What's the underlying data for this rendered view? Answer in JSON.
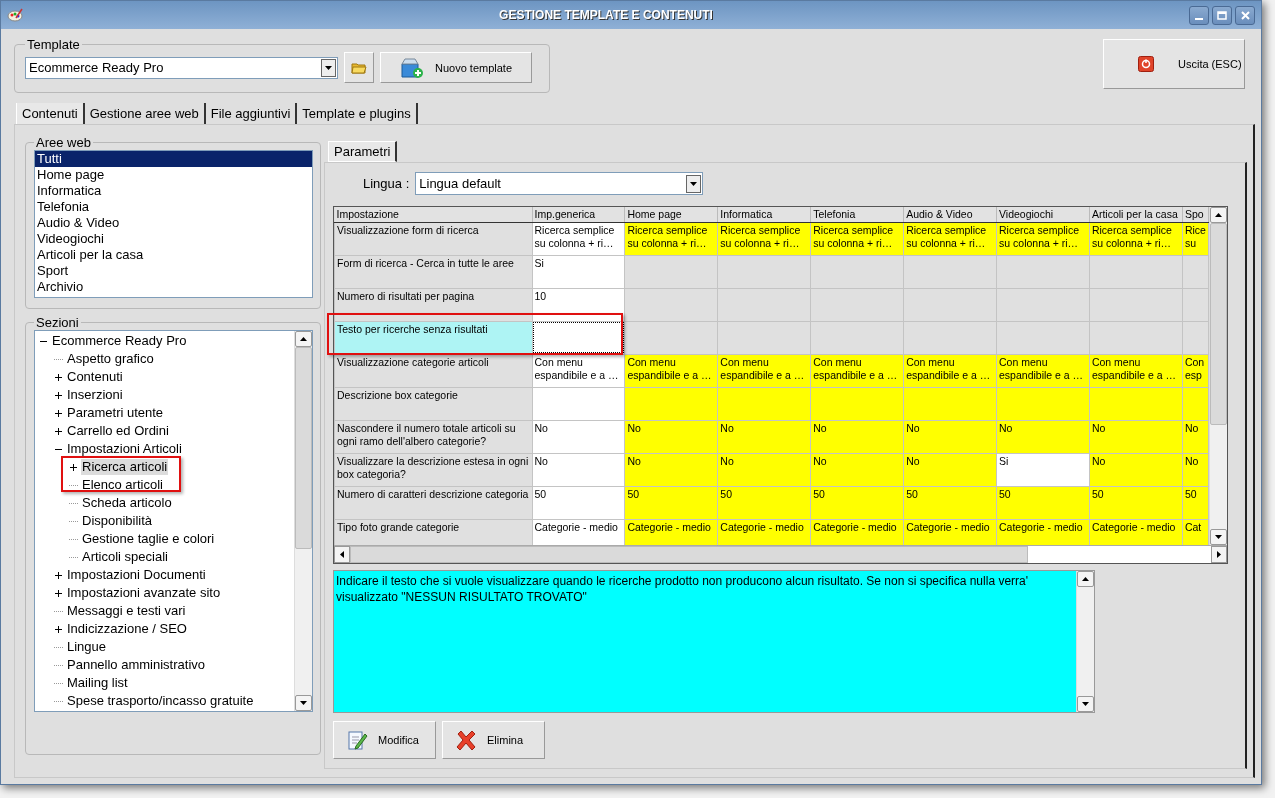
{
  "window": {
    "title": "GESTIONE TEMPLATE E CONTENUTI"
  },
  "template": {
    "legend": "Template",
    "value": "Ecommerce Ready Pro",
    "new_button": "Nuovo template"
  },
  "exit_button": "Uscita (ESC)",
  "tabs": [
    {
      "label": "Contenuti",
      "selected": true
    },
    {
      "label": "Gestione aree web",
      "selected": false
    },
    {
      "label": "File aggiuntivi",
      "selected": false
    },
    {
      "label": "Template e plugins",
      "selected": false
    }
  ],
  "web_areas": {
    "legend": "Aree web",
    "items": [
      {
        "label": "Tutti",
        "selected": true
      },
      {
        "label": "Home page",
        "selected": false
      },
      {
        "label": "Informatica",
        "selected": false
      },
      {
        "label": "Telefonia",
        "selected": false
      },
      {
        "label": "Audio & Video",
        "selected": false
      },
      {
        "label": "Videogiochi",
        "selected": false
      },
      {
        "label": "Articoli per la casa",
        "selected": false
      },
      {
        "label": "Sport",
        "selected": false
      },
      {
        "label": "Archivio",
        "selected": false
      }
    ]
  },
  "sections": {
    "legend": "Sezioni",
    "tree": [
      {
        "label": "Ecommerce Ready Pro",
        "kind": "folder",
        "expanded": true,
        "selected": false,
        "highlighted": false,
        "children": [
          {
            "label": "Aspetto grafico",
            "kind": "leaf",
            "selected": false,
            "highlighted": false
          },
          {
            "label": "Contenuti",
            "kind": "folder",
            "expanded": false,
            "selected": false,
            "highlighted": false
          },
          {
            "label": "Inserzioni",
            "kind": "folder",
            "expanded": false,
            "selected": false,
            "highlighted": false
          },
          {
            "label": "Parametri utente",
            "kind": "folder",
            "expanded": false,
            "selected": false,
            "highlighted": false
          },
          {
            "label": "Carrello ed Ordini",
            "kind": "folder",
            "expanded": false,
            "selected": false,
            "highlighted": false
          },
          {
            "label": "Impostazioni Articoli",
            "kind": "folder",
            "expanded": true,
            "selected": false,
            "highlighted": false,
            "children": [
              {
                "label": "Ricerca articoli",
                "kind": "folder",
                "expanded": false,
                "selected": true,
                "highlighted": true
              },
              {
                "label": "Elenco articoli",
                "kind": "leaf",
                "selected": false,
                "highlighted": false
              },
              {
                "label": "Scheda articolo",
                "kind": "leaf",
                "selected": false,
                "highlighted": false
              },
              {
                "label": "Disponibilità",
                "kind": "leaf",
                "selected": false,
                "highlighted": false
              },
              {
                "label": "Gestione taglie e colori",
                "kind": "leaf",
                "selected": false,
                "highlighted": false
              },
              {
                "label": "Articoli speciali",
                "kind": "leaf",
                "selected": false,
                "highlighted": false
              }
            ]
          },
          {
            "label": "Impostazioni Documenti",
            "kind": "folder",
            "expanded": false,
            "selected": false,
            "highlighted": false
          },
          {
            "label": "Impostazioni avanzate sito",
            "kind": "folder",
            "expanded": false,
            "selected": false,
            "highlighted": false
          },
          {
            "label": "Messaggi e testi vari",
            "kind": "leaf",
            "selected": false,
            "highlighted": false
          },
          {
            "label": "Indicizzazione / SEO",
            "kind": "folder",
            "expanded": false,
            "selected": false,
            "highlighted": false
          },
          {
            "label": "Lingue",
            "kind": "leaf",
            "selected": false,
            "highlighted": false
          },
          {
            "label": "Pannello amministrativo",
            "kind": "leaf",
            "selected": false,
            "highlighted": false
          },
          {
            "label": "Mailing list",
            "kind": "leaf",
            "selected": false,
            "highlighted": false
          },
          {
            "label": "Spese trasporto/incasso gratuite",
            "kind": "leaf",
            "selected": false,
            "highlighted": false
          }
        ]
      }
    ]
  },
  "parameters": {
    "tab": "Parametri",
    "language_label": "Lingua :",
    "language": "Lingua default",
    "label_column": "Impostazione",
    "columns": [
      "Imp.generica",
      "Home page",
      "Informatica",
      "Telefonia",
      "Audio & Video",
      "Videogiochi",
      "Articoli per la casa",
      "Spo"
    ],
    "rows": [
      {
        "label": "Visualizzazione form di ricerca",
        "selected": false,
        "highlighted": false,
        "cells": [
          {
            "text": "Ricerca semplice\nsu colonna + ri…",
            "kind": "value"
          },
          {
            "text": "Ricerca semplice\nsu colonna + ri…",
            "kind": "override"
          },
          {
            "text": "Ricerca semplice\nsu colonna + ri…",
            "kind": "override"
          },
          {
            "text": "Ricerca semplice\nsu colonna + ri…",
            "kind": "override"
          },
          {
            "text": "Ricerca semplice\nsu colonna + ri…",
            "kind": "override"
          },
          {
            "text": "Ricerca semplice\nsu colonna + ri…",
            "kind": "override"
          },
          {
            "text": "Ricerca semplice\nsu colonna + ri…",
            "kind": "override"
          },
          {
            "text": "Rice\nsu",
            "kind": "override"
          }
        ]
      },
      {
        "label": "Form di ricerca - Cerca in tutte le aree",
        "selected": false,
        "highlighted": false,
        "cells": [
          {
            "text": "Si",
            "kind": "value"
          },
          {
            "kind": "empty"
          },
          {
            "kind": "empty"
          },
          {
            "kind": "empty"
          },
          {
            "kind": "empty"
          },
          {
            "kind": "empty"
          },
          {
            "kind": "empty"
          },
          {
            "kind": "empty"
          }
        ]
      },
      {
        "label": "Numero di risultati per pagina",
        "selected": false,
        "highlighted": false,
        "cells": [
          {
            "text": "10",
            "kind": "value"
          },
          {
            "kind": "empty"
          },
          {
            "kind": "empty"
          },
          {
            "kind": "empty"
          },
          {
            "kind": "empty"
          },
          {
            "kind": "empty"
          },
          {
            "kind": "empty"
          },
          {
            "kind": "empty"
          }
        ]
      },
      {
        "label": "Testo per ricerche senza risultati",
        "selected": true,
        "highlighted": true,
        "cells": [
          {
            "kind": "value"
          },
          {
            "kind": "empty"
          },
          {
            "kind": "empty"
          },
          {
            "kind": "empty"
          },
          {
            "kind": "empty"
          },
          {
            "kind": "empty"
          },
          {
            "kind": "empty"
          },
          {
            "kind": "empty"
          }
        ]
      },
      {
        "label": "Visualizzazione categorie articoli",
        "selected": false,
        "highlighted": false,
        "cells": [
          {
            "text": "Con menu\nespandibile e a …",
            "kind": "value"
          },
          {
            "text": "Con menu\nespandibile e a …",
            "kind": "override"
          },
          {
            "text": "Con menu\nespandibile e a …",
            "kind": "override"
          },
          {
            "text": "Con menu\nespandibile e a …",
            "kind": "override"
          },
          {
            "text": "Con menu\nespandibile e a …",
            "kind": "override"
          },
          {
            "text": "Con menu\nespandibile e a …",
            "kind": "override"
          },
          {
            "text": "Con menu\nespandibile e a …",
            "kind": "override"
          },
          {
            "text": "Con\nesp",
            "kind": "override"
          }
        ]
      },
      {
        "label": "Descrizione box categorie",
        "selected": false,
        "highlighted": false,
        "cells": [
          {
            "kind": "value"
          },
          {
            "kind": "override"
          },
          {
            "kind": "override"
          },
          {
            "kind": "override"
          },
          {
            "kind": "override"
          },
          {
            "kind": "override"
          },
          {
            "kind": "override"
          },
          {
            "kind": "override"
          }
        ]
      },
      {
        "label": "Nascondere il numero totale articoli su ogni ramo dell'albero categorie?",
        "selected": false,
        "highlighted": false,
        "cells": [
          {
            "text": "No",
            "kind": "value"
          },
          {
            "text": "No",
            "kind": "override"
          },
          {
            "text": "No",
            "kind": "override"
          },
          {
            "text": "No",
            "kind": "override"
          },
          {
            "text": "No",
            "kind": "override"
          },
          {
            "text": "No",
            "kind": "override"
          },
          {
            "text": "No",
            "kind": "override"
          },
          {
            "text": "No",
            "kind": "override"
          }
        ]
      },
      {
        "label": "Visualizzare la descrizione estesa in ogni box categoria?",
        "selected": false,
        "highlighted": false,
        "cells": [
          {
            "text": "No",
            "kind": "value"
          },
          {
            "text": "No",
            "kind": "override"
          },
          {
            "text": "No",
            "kind": "override"
          },
          {
            "text": "No",
            "kind": "override"
          },
          {
            "text": "No",
            "kind": "override"
          },
          {
            "text": "Si",
            "kind": "value"
          },
          {
            "text": "No",
            "kind": "override"
          },
          {
            "text": "No",
            "kind": "override"
          }
        ]
      },
      {
        "label": "Numero di caratteri descrizione categoria",
        "selected": false,
        "highlighted": false,
        "cells": [
          {
            "text": "50",
            "kind": "value"
          },
          {
            "text": "50",
            "kind": "override"
          },
          {
            "text": "50",
            "kind": "override"
          },
          {
            "text": "50",
            "kind": "override"
          },
          {
            "text": "50",
            "kind": "override"
          },
          {
            "text": "50",
            "kind": "override"
          },
          {
            "text": "50",
            "kind": "override"
          },
          {
            "text": "50",
            "kind": "override"
          }
        ]
      },
      {
        "label": "Tipo foto grande categorie",
        "selected": false,
        "highlighted": false,
        "cells": [
          {
            "text": "Categorie - medio",
            "kind": "value"
          },
          {
            "text": "Categorie - medio",
            "kind": "override"
          },
          {
            "text": "Categorie - medio",
            "kind": "override"
          },
          {
            "text": "Categorie - medio",
            "kind": "override"
          },
          {
            "text": "Categorie - medio",
            "kind": "override"
          },
          {
            "text": "Categorie - medio",
            "kind": "override"
          },
          {
            "text": "Categorie - medio",
            "kind": "override"
          },
          {
            "text": "Cat",
            "kind": "override"
          }
        ]
      }
    ],
    "description": "Indicare il testo che si vuole visualizzare quando le ricerche prodotto non producono alcun risultato. Se non si specifica nulla verra' visualizzato \"NESSUN RISULTATO TROVATO\"",
    "buttons": [
      {
        "label": "Modifica",
        "kind": "edit"
      },
      {
        "label": "Elimina",
        "kind": "delete"
      }
    ]
  }
}
